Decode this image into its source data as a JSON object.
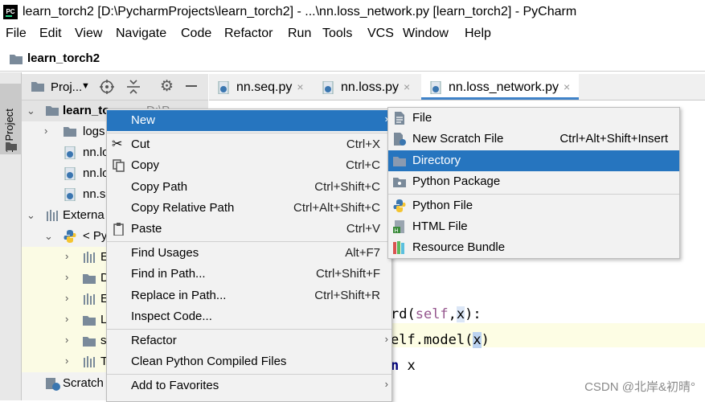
{
  "window": {
    "title": "learn_torch2 [D:\\PycharmProjects\\learn_torch2] - ...\\nn.loss_network.py [learn_torch2] - PyCharm"
  },
  "menubar": [
    "File",
    "Edit",
    "View",
    "Navigate",
    "Code",
    "Refactor",
    "Run",
    "Tools",
    "VCS",
    "Window",
    "Help"
  ],
  "navbar": {
    "project": "learn_torch2"
  },
  "toolstrip": {
    "project_tab": "1: Project"
  },
  "project_panel": {
    "header": "Proj...",
    "tree": [
      {
        "label": "learn_to",
        "suffix": "D:\\P..."
      },
      {
        "label": "logs"
      },
      {
        "label": "nn.lo"
      },
      {
        "label": "nn.lo"
      },
      {
        "label": "nn.s"
      },
      {
        "label": "Externa"
      },
      {
        "label": "< Py"
      },
      {
        "label": "E"
      },
      {
        "label": "D"
      },
      {
        "label": "E"
      },
      {
        "label": "L"
      },
      {
        "label": "s"
      },
      {
        "label": "T"
      },
      {
        "label": "Scratch"
      }
    ]
  },
  "tabs": [
    {
      "label": "nn.seq.py",
      "close": "×"
    },
    {
      "label": "nn.loss.py",
      "close": "×"
    },
    {
      "label": "nn.loss_network.py",
      "close": "×"
    }
  ],
  "editor": {
    "line1_a": "rd(",
    "line1_b": "self",
    "line1_c": ",",
    "line1_d": "x",
    "line1_e": "):",
    "line2_a": "elf.model(",
    "line2_b": "x",
    "line2_c": ")",
    "line3_a": "n",
    "line3_b": " x"
  },
  "context_menu": {
    "new": "New",
    "cut": "Cut",
    "cut_sc": "Ctrl+X",
    "copy": "Copy",
    "copy_sc": "Ctrl+C",
    "copy_path": "Copy Path",
    "copy_path_sc": "Ctrl+Shift+C",
    "copy_rel": "Copy Relative Path",
    "copy_rel_sc": "Ctrl+Alt+Shift+C",
    "paste": "Paste",
    "paste_sc": "Ctrl+V",
    "find_usages": "Find Usages",
    "find_usages_sc": "Alt+F7",
    "find_in_path": "Find in Path...",
    "find_in_path_sc": "Ctrl+Shift+F",
    "replace_in_path": "Replace in Path...",
    "replace_in_path_sc": "Ctrl+Shift+R",
    "inspect_code": "Inspect Code...",
    "refactor": "Refactor",
    "clean_compiled": "Clean Python Compiled Files",
    "add_favorites": "Add to Favorites"
  },
  "submenu": {
    "file": "File",
    "scratch": "New Scratch File",
    "scratch_sc": "Ctrl+Alt+Shift+Insert",
    "directory": "Directory",
    "python_package": "Python Package",
    "python_file": "Python File",
    "html_file": "HTML File",
    "resource_bundle": "Resource Bundle"
  },
  "watermark": "CSDN @北岸&初晴°",
  "colors": {
    "selection": "#2675bf",
    "active_tab_underline": "#4083c9",
    "folder": "#7a8a9a",
    "keyword": "#000080",
    "self_kw": "#94558d"
  }
}
